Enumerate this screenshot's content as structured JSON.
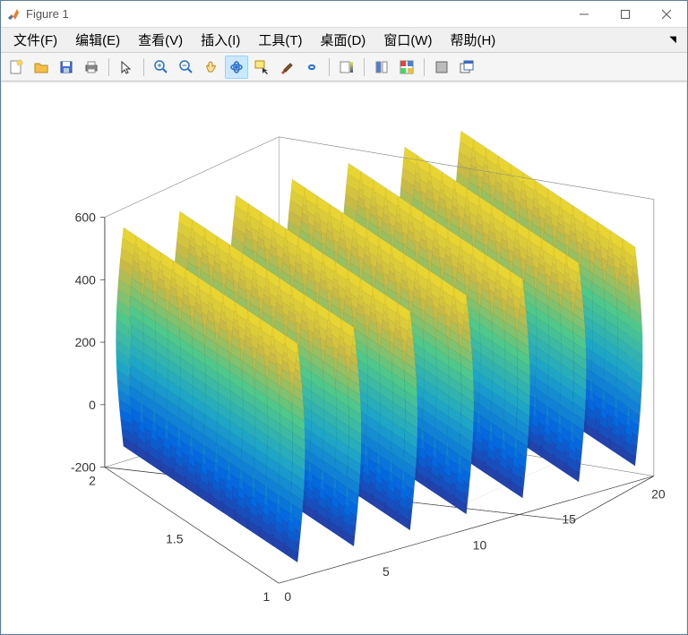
{
  "window": {
    "title": "Figure 1"
  },
  "menu": {
    "items": [
      "文件(F)",
      "编辑(E)",
      "查看(V)",
      "插入(I)",
      "工具(T)",
      "桌面(D)",
      "窗口(W)",
      "帮助(H)"
    ]
  },
  "toolbar": {
    "groups": [
      [
        "new-figure-icon",
        "open-file-icon",
        "save-icon",
        "print-icon"
      ],
      [
        "pointer-icon"
      ],
      [
        "zoom-in-icon",
        "zoom-out-icon",
        "pan-icon",
        "rotate-3d-icon",
        "data-cursor-icon",
        "brush-icon",
        "link-icon"
      ],
      [
        "colorbar-icon"
      ],
      [
        "legend-icon",
        "layout-icon"
      ],
      [
        "dock-icon",
        "undock-icon"
      ]
    ],
    "pressed": "rotate-3d-icon"
  },
  "chart_data": {
    "type": "surface3d",
    "description": "3D mesh/surface of multiple vertical sheet-like lobes, periodic in x, colored by height (parula-like colormap from blue low to yellow high).",
    "x_range": [
      0,
      20
    ],
    "y_range": [
      1,
      2
    ],
    "z_range": [
      -200,
      600
    ],
    "x_ticks": [
      0,
      5,
      10,
      15,
      20
    ],
    "y_ticks": [
      1,
      1.5,
      2
    ],
    "z_ticks": [
      -200,
      0,
      200,
      400,
      600
    ],
    "sheet_x_centers": [
      1.0,
      4.0,
      7.0,
      10.0,
      13.0,
      16.0,
      19.0
    ],
    "sheet_width": 0.8,
    "z_peak": 550,
    "z_trough": -150,
    "colormap": "parula"
  }
}
